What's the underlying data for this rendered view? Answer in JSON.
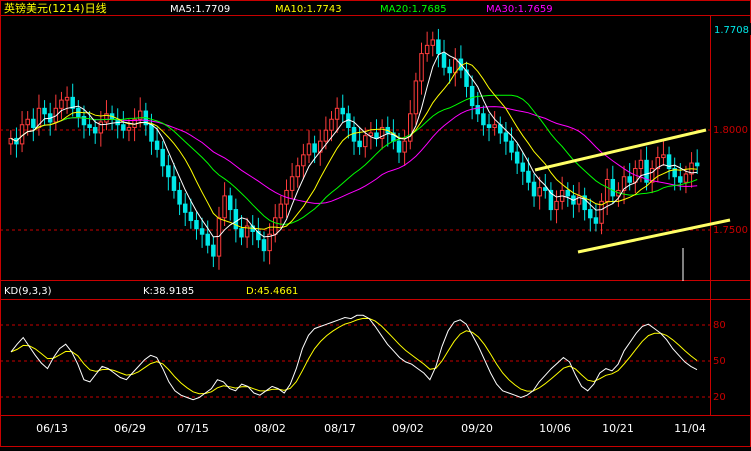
{
  "header": {
    "title": "英镑美元(1214)日线",
    "ma5": "MA5:1.7709",
    "ma10": "MA10:1.7743",
    "ma20": "MA20:1.7685",
    "ma30": "MA30:1.7659",
    "last_price": "1.7708"
  },
  "indicator": {
    "name": "KD(9,3,3)",
    "k": "K:38.9185",
    "d": "D:45.4661"
  },
  "colors": {
    "up": "#ff3c3c",
    "down": "#00e8e8",
    "ma5": "#ffffff",
    "ma10": "#ffff00",
    "ma20": "#00ff00",
    "ma30": "#ff00ff",
    "frame": "#c80000",
    "trendline": "#ffff66"
  },
  "chart_data": [
    {
      "type": "candlestick",
      "title": "英镑美元(1214)日线",
      "ylim": [
        1.73,
        1.825
      ],
      "y_ticks": [
        "1.8000",
        "1.7500"
      ],
      "x_tick_labels": [
        "06/13",
        "06/29",
        "07/15",
        "08/02",
        "08/17",
        "09/02",
        "09/20",
        "10/06",
        "10/21",
        "11/04"
      ],
      "last_value": "1.7708",
      "close": [
        1.781,
        1.779,
        1.786,
        1.788,
        1.785,
        1.792,
        1.79,
        1.787,
        1.792,
        1.795,
        1.796,
        1.792,
        1.789,
        1.786,
        1.785,
        1.783,
        1.787,
        1.79,
        1.788,
        1.786,
        1.784,
        1.785,
        1.788,
        1.791,
        1.786,
        1.78,
        1.777,
        1.771,
        1.767,
        1.762,
        1.757,
        1.754,
        1.751,
        1.748,
        1.746,
        1.742,
        1.738,
        1.752,
        1.76,
        1.755,
        1.748,
        1.745,
        1.749,
        1.747,
        1.744,
        1.74,
        1.746,
        1.752,
        1.757,
        1.762,
        1.767,
        1.771,
        1.775,
        1.779,
        1.776,
        1.78,
        1.784,
        1.788,
        1.792,
        1.79,
        1.785,
        1.78,
        1.778,
        1.782,
        1.783,
        1.781,
        1.785,
        1.783,
        1.78,
        1.776,
        1.78,
        1.79,
        1.802,
        1.812,
        1.815,
        1.817,
        1.812,
        1.807,
        1.805,
        1.81,
        1.806,
        1.8,
        1.793,
        1.79,
        1.786,
        1.785,
        1.786,
        1.783,
        1.78,
        1.776,
        1.772,
        1.769,
        1.765,
        1.76,
        1.763,
        1.762,
        1.755,
        1.758,
        1.762,
        1.76,
        1.757,
        1.76,
        1.755,
        1.752,
        1.75,
        1.758,
        1.766,
        1.76,
        1.762,
        1.767,
        1.765,
        1.77,
        1.773,
        1.765,
        1.77,
        1.774,
        1.775,
        1.77,
        1.767,
        1.765,
        1.768,
        1.772,
        1.771
      ],
      "series": [
        {
          "name": "MA5",
          "last": 1.7709
        },
        {
          "name": "MA10",
          "last": 1.7743
        },
        {
          "name": "MA20",
          "last": 1.7685
        },
        {
          "name": "MA30",
          "last": 1.7659
        }
      ]
    },
    {
      "type": "line",
      "title": "KD(9,3,3)",
      "ylim": [
        0,
        100
      ],
      "y_ticks": [
        "80",
        "50",
        "20"
      ],
      "series": [
        {
          "name": "K",
          "last": 38.9185
        },
        {
          "name": "D",
          "last": 45.4661
        }
      ],
      "k": [
        55,
        62,
        68,
        60,
        52,
        45,
        40,
        50,
        58,
        62,
        55,
        44,
        30,
        28,
        35,
        42,
        40,
        36,
        32,
        30,
        36,
        42,
        48,
        52,
        50,
        40,
        28,
        20,
        16,
        14,
        12,
        14,
        18,
        22,
        30,
        28,
        22,
        20,
        26,
        24,
        18,
        16,
        20,
        24,
        22,
        18,
        26,
        40,
        58,
        70,
        76,
        78,
        80,
        82,
        84,
        86,
        85,
        88,
        88,
        85,
        78,
        70,
        62,
        56,
        50,
        46,
        44,
        40,
        36,
        30,
        42,
        60,
        74,
        82,
        84,
        80,
        70,
        60,
        48,
        36,
        26,
        20,
        18,
        16,
        14,
        16,
        20,
        28,
        34,
        40,
        45,
        50,
        46,
        34,
        24,
        20,
        26,
        36,
        40,
        38,
        44,
        56,
        64,
        72,
        78,
        80,
        76,
        72,
        66,
        58,
        52,
        46,
        42,
        39
      ]
    }
  ]
}
